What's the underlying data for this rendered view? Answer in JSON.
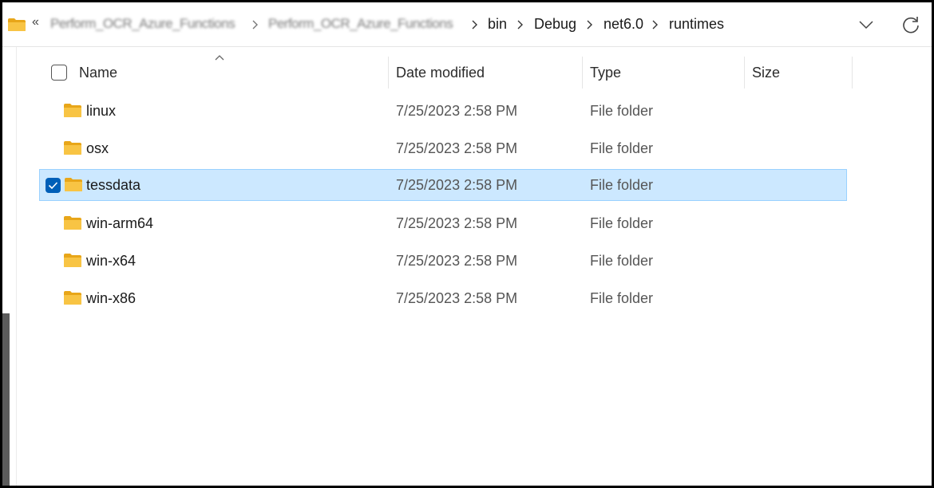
{
  "breadcrumb": {
    "overflow": "«",
    "items": [
      {
        "label": "Perform_OCR_Azure_Functions",
        "blurred": true
      },
      {
        "label": "Perform_OCR_Azure_Functions",
        "blurred": true
      },
      {
        "label": "bin",
        "blurred": false
      },
      {
        "label": "Debug",
        "blurred": false
      },
      {
        "label": "net6.0",
        "blurred": false
      },
      {
        "label": "runtimes",
        "blurred": false
      }
    ],
    "dropdown_icon": "chevron-down-icon",
    "refresh_icon": "refresh-icon"
  },
  "columns": {
    "name": "Name",
    "date_modified": "Date modified",
    "type": "Type",
    "size": "Size",
    "sort_icon": "chevron-up-icon"
  },
  "files": [
    {
      "name": "linux",
      "date": "7/25/2023 2:58 PM",
      "type": "File folder",
      "size": "",
      "selected": false
    },
    {
      "name": "osx",
      "date": "7/25/2023 2:58 PM",
      "type": "File folder",
      "size": "",
      "selected": false
    },
    {
      "name": "tessdata",
      "date": "7/25/2023 2:58 PM",
      "type": "File folder",
      "size": "",
      "selected": true
    },
    {
      "name": "win-arm64",
      "date": "7/25/2023 2:58 PM",
      "type": "File folder",
      "size": "",
      "selected": false
    },
    {
      "name": "win-x64",
      "date": "7/25/2023 2:58 PM",
      "type": "File folder",
      "size": "",
      "selected": false
    },
    {
      "name": "win-x86",
      "date": "7/25/2023 2:58 PM",
      "type": "File folder",
      "size": "",
      "selected": false
    }
  ],
  "colors": {
    "selection_bg": "#cce8ff",
    "selection_border": "#99d1ff",
    "checkbox_accent": "#005fb8",
    "folder_yellow": "#f8c444"
  }
}
